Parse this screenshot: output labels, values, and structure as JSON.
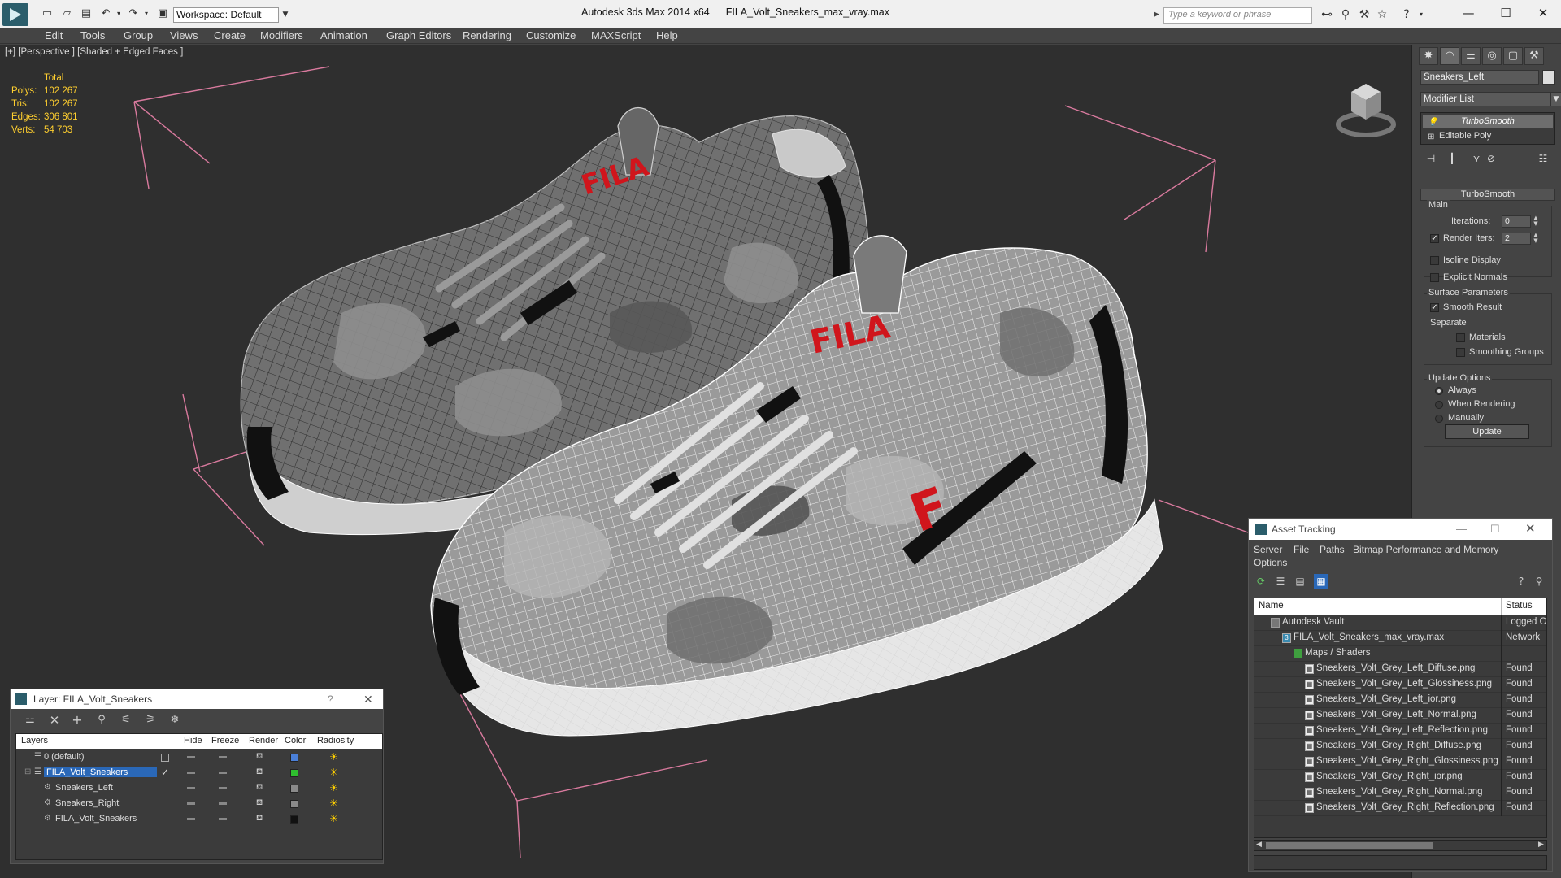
{
  "titlebar": {
    "workspace": "Workspace: Default",
    "app_name": "Autodesk 3ds Max  2014 x64",
    "file_name": "FILA_Volt_Sneakers_max_vray.max",
    "search_placeholder": "Type a keyword or phrase"
  },
  "menu": [
    "Edit",
    "Tools",
    "Group",
    "Views",
    "Create",
    "Modifiers",
    "Animation",
    "Graph Editors",
    "Rendering",
    "Customize",
    "MAXScript",
    "Help"
  ],
  "viewport": {
    "label": "[+] [Perspective ] [Shaded + Edged Faces ]",
    "stats": {
      "total_label": "Total",
      "rows": [
        {
          "k": "Polys:",
          "v": "102 267"
        },
        {
          "k": "Tris:",
          "v": "102 267"
        },
        {
          "k": "Edges:",
          "v": "306 801"
        },
        {
          "k": "Verts:",
          "v": "54 703"
        }
      ]
    },
    "logo_left": "FILA",
    "logo_right": "FILA",
    "logo_side": "F"
  },
  "command_panel": {
    "object_name": "Sneakers_Left",
    "modifier_list": "Modifier List",
    "stack": [
      "TurboSmooth",
      "Editable Poly"
    ],
    "rollout": "TurboSmooth",
    "main_group": "Main",
    "iterations_label": "Iterations:",
    "iterations": "0",
    "render_iters_label": "Render Iters:",
    "render_iters": "2",
    "isoline": "Isoline Display",
    "explicit_normals": "Explicit Normals",
    "surface_group": "Surface Parameters",
    "smooth_result": "Smooth Result",
    "separate": "Separate",
    "materials": "Materials",
    "smoothing_groups": "Smoothing Groups",
    "update_group": "Update Options",
    "always": "Always",
    "when_rendering": "When Rendering",
    "manually": "Manually",
    "update_button": "Update"
  },
  "layer_dialog": {
    "title": "Layer: FILA_Volt_Sneakers",
    "help": "?",
    "columns": [
      "Layers",
      "Hide",
      "Freeze",
      "Render",
      "Color",
      "Radiosity"
    ],
    "rows": [
      {
        "name": "0 (default)",
        "color": "#4a7fd8"
      },
      {
        "name": "FILA_Volt_Sneakers",
        "color": "#2fbf2f"
      },
      {
        "name": "Sneakers_Left",
        "color": "#8a8a8a"
      },
      {
        "name": "Sneakers_Right",
        "color": "#8a8a8a"
      },
      {
        "name": "FILA_Volt_Sneakers",
        "color": "#111111"
      }
    ]
  },
  "asset_dialog": {
    "title": "Asset Tracking",
    "menu": [
      "Server",
      "File",
      "Paths",
      "Bitmap Performance and Memory",
      "Options"
    ],
    "col_name": "Name",
    "col_status": "Status",
    "rows": [
      {
        "name": "Autodesk Vault",
        "status": "Logged O"
      },
      {
        "name": "FILA_Volt_Sneakers_max_vray.max",
        "status": "Network"
      },
      {
        "name": "Maps / Shaders",
        "status": ""
      },
      {
        "name": "Sneakers_Volt_Grey_Left_Diffuse.png",
        "status": "Found"
      },
      {
        "name": "Sneakers_Volt_Grey_Left_Glossiness.png",
        "status": "Found"
      },
      {
        "name": "Sneakers_Volt_Grey_Left_ior.png",
        "status": "Found"
      },
      {
        "name": "Sneakers_Volt_Grey_Left_Normal.png",
        "status": "Found"
      },
      {
        "name": "Sneakers_Volt_Grey_Left_Reflection.png",
        "status": "Found"
      },
      {
        "name": "Sneakers_Volt_Grey_Right_Diffuse.png",
        "status": "Found"
      },
      {
        "name": "Sneakers_Volt_Grey_Right_Glossiness.png",
        "status": "Found"
      },
      {
        "name": "Sneakers_Volt_Grey_Right_ior.png",
        "status": "Found"
      },
      {
        "name": "Sneakers_Volt_Grey_Right_Normal.png",
        "status": "Found"
      },
      {
        "name": "Sneakers_Volt_Grey_Right_Reflection.png",
        "status": "Found"
      }
    ]
  },
  "colors": {
    "stats_yellow": "#ffcf2f",
    "viewport_bg": "#2f2f2f",
    "fila_red": "#d0151c",
    "selection_blue": "#2a68b8"
  }
}
